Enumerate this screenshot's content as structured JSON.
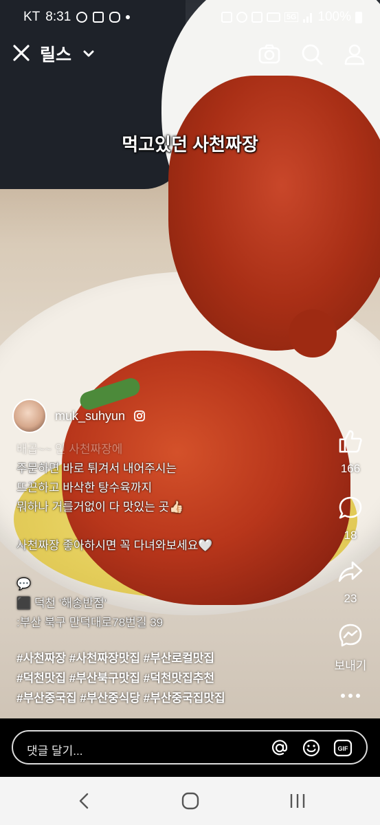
{
  "status": {
    "carrier": "KT",
    "time": "8:31",
    "network": "5G",
    "battery": "100%"
  },
  "header": {
    "title": "릴스",
    "close_icon": "close-icon",
    "dropdown_icon": "chevron-down-icon",
    "camera_icon": "camera-icon",
    "search_icon": "search-icon",
    "profile_icon": "person-icon"
  },
  "video": {
    "overlay_text": "먹고있던 사천짜장"
  },
  "actions": {
    "likes": "166",
    "comments": "18",
    "shares": "23",
    "send_label": "보내기"
  },
  "post": {
    "username": "muk_suhyun",
    "lines_faded": "배곱~~ 인 사천짜장에",
    "lines": [
      "주문하면 바로 튀겨서 내어주시는",
      "뜨끈하고 바삭한 탕수육까지",
      "뭐하나 거를거없이 다 맛있는 곳👍🏻",
      "",
      "사천짜장 좋아하시면 꼭 다녀와보세요🤍",
      "",
      "💬",
      "⬛ 덕천 '해송반점'",
      ":부산 북구 만덕대로78번길 39"
    ],
    "hashtags": [
      "#사천짜장 #사천짜장맛집 #부산로컬맛집",
      "#덕천맛집 #부산북구맛집 #덕천맛집추천",
      "#부산중국집 #부산중식당 #부산중국집맛집"
    ]
  },
  "comment": {
    "placeholder": "댓글 달기..."
  }
}
